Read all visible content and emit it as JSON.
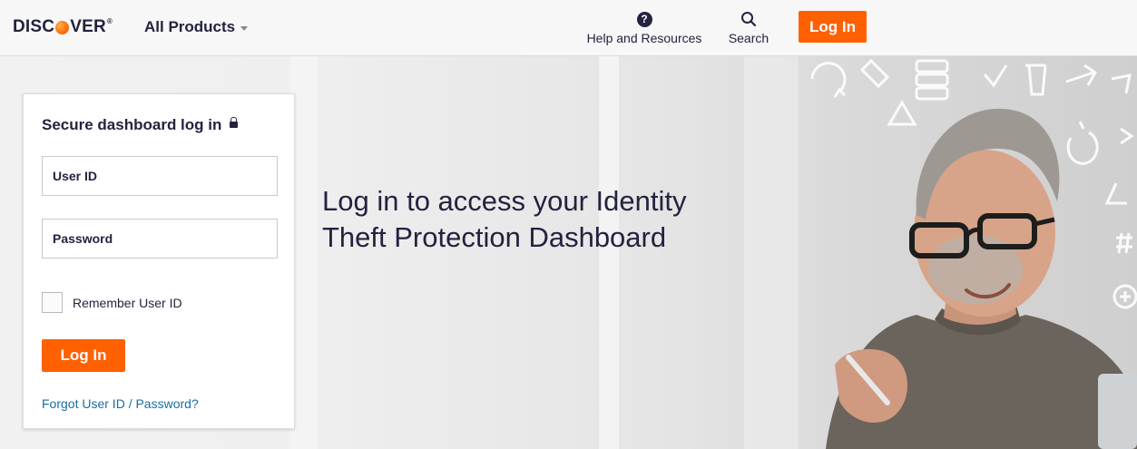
{
  "header": {
    "logo_text": "DISCOVER",
    "all_products_label": "All Products",
    "help_label": "Help and Resources",
    "search_label": "Search",
    "login_label": "Log In"
  },
  "hero": {
    "title": "Log in to access your Identity Theft Protection Dashboard"
  },
  "login_card": {
    "title": "Secure dashboard log in",
    "user_id_placeholder": "User ID",
    "password_placeholder": "Password",
    "remember_label": "Remember User ID",
    "remember_checked": false,
    "login_label": "Log In",
    "forgot_link": "Forgot User ID / Password?"
  },
  "icons": {
    "help": "question-circle-icon",
    "search": "magnifier-icon",
    "lock": "lock-icon",
    "caret": "chevron-down-icon"
  },
  "colors": {
    "accent": "#ff6000",
    "text": "#23233f",
    "link": "#1a6ea0"
  }
}
